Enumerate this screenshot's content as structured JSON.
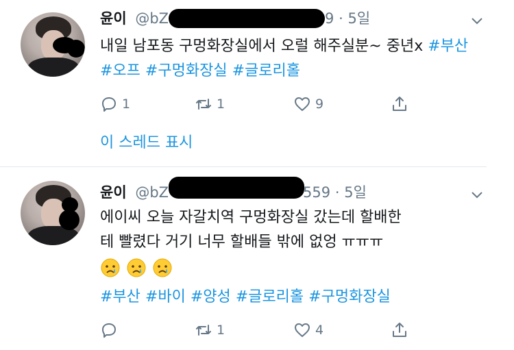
{
  "tweets": [
    {
      "name": "윤이",
      "handle_start": "@bZ",
      "handle_end": "9",
      "separator": "·",
      "time": "5일",
      "text": "내일 남포동 구멍화장실에서 오럴 해주실분~ 중년x",
      "hashtags": [
        "#부산",
        "#오프",
        "#구멍화장실",
        "#글로리홀"
      ],
      "reply_count": "1",
      "retweet_count": "1",
      "like_count": "9",
      "thread_link": "이 스레드 표시"
    },
    {
      "name": "윤이",
      "handle_start": "@bZ",
      "handle_end": "559",
      "separator": "·",
      "time": "5일",
      "text_line1": "에이씨 오늘 자갈치역 구멍화장실 갔는데 할배한",
      "text_line2": "테 빨렸다 거기 너무 할배들 밖에 없엉 ㅠㅠㅠ",
      "emojis": [
        "crying-face-emoji",
        "crying-face-emoji",
        "crying-face-emoji"
      ],
      "hashtags": [
        "#부산",
        "#바이",
        "#양성",
        "#글로리홀",
        "#구멍화장실"
      ],
      "reply_count": "",
      "retweet_count": "1",
      "like_count": "4"
    }
  ],
  "colors": {
    "link": "#1b95e0",
    "meta": "#657786",
    "text": "#14171a",
    "divider": "#e1e8ed"
  }
}
